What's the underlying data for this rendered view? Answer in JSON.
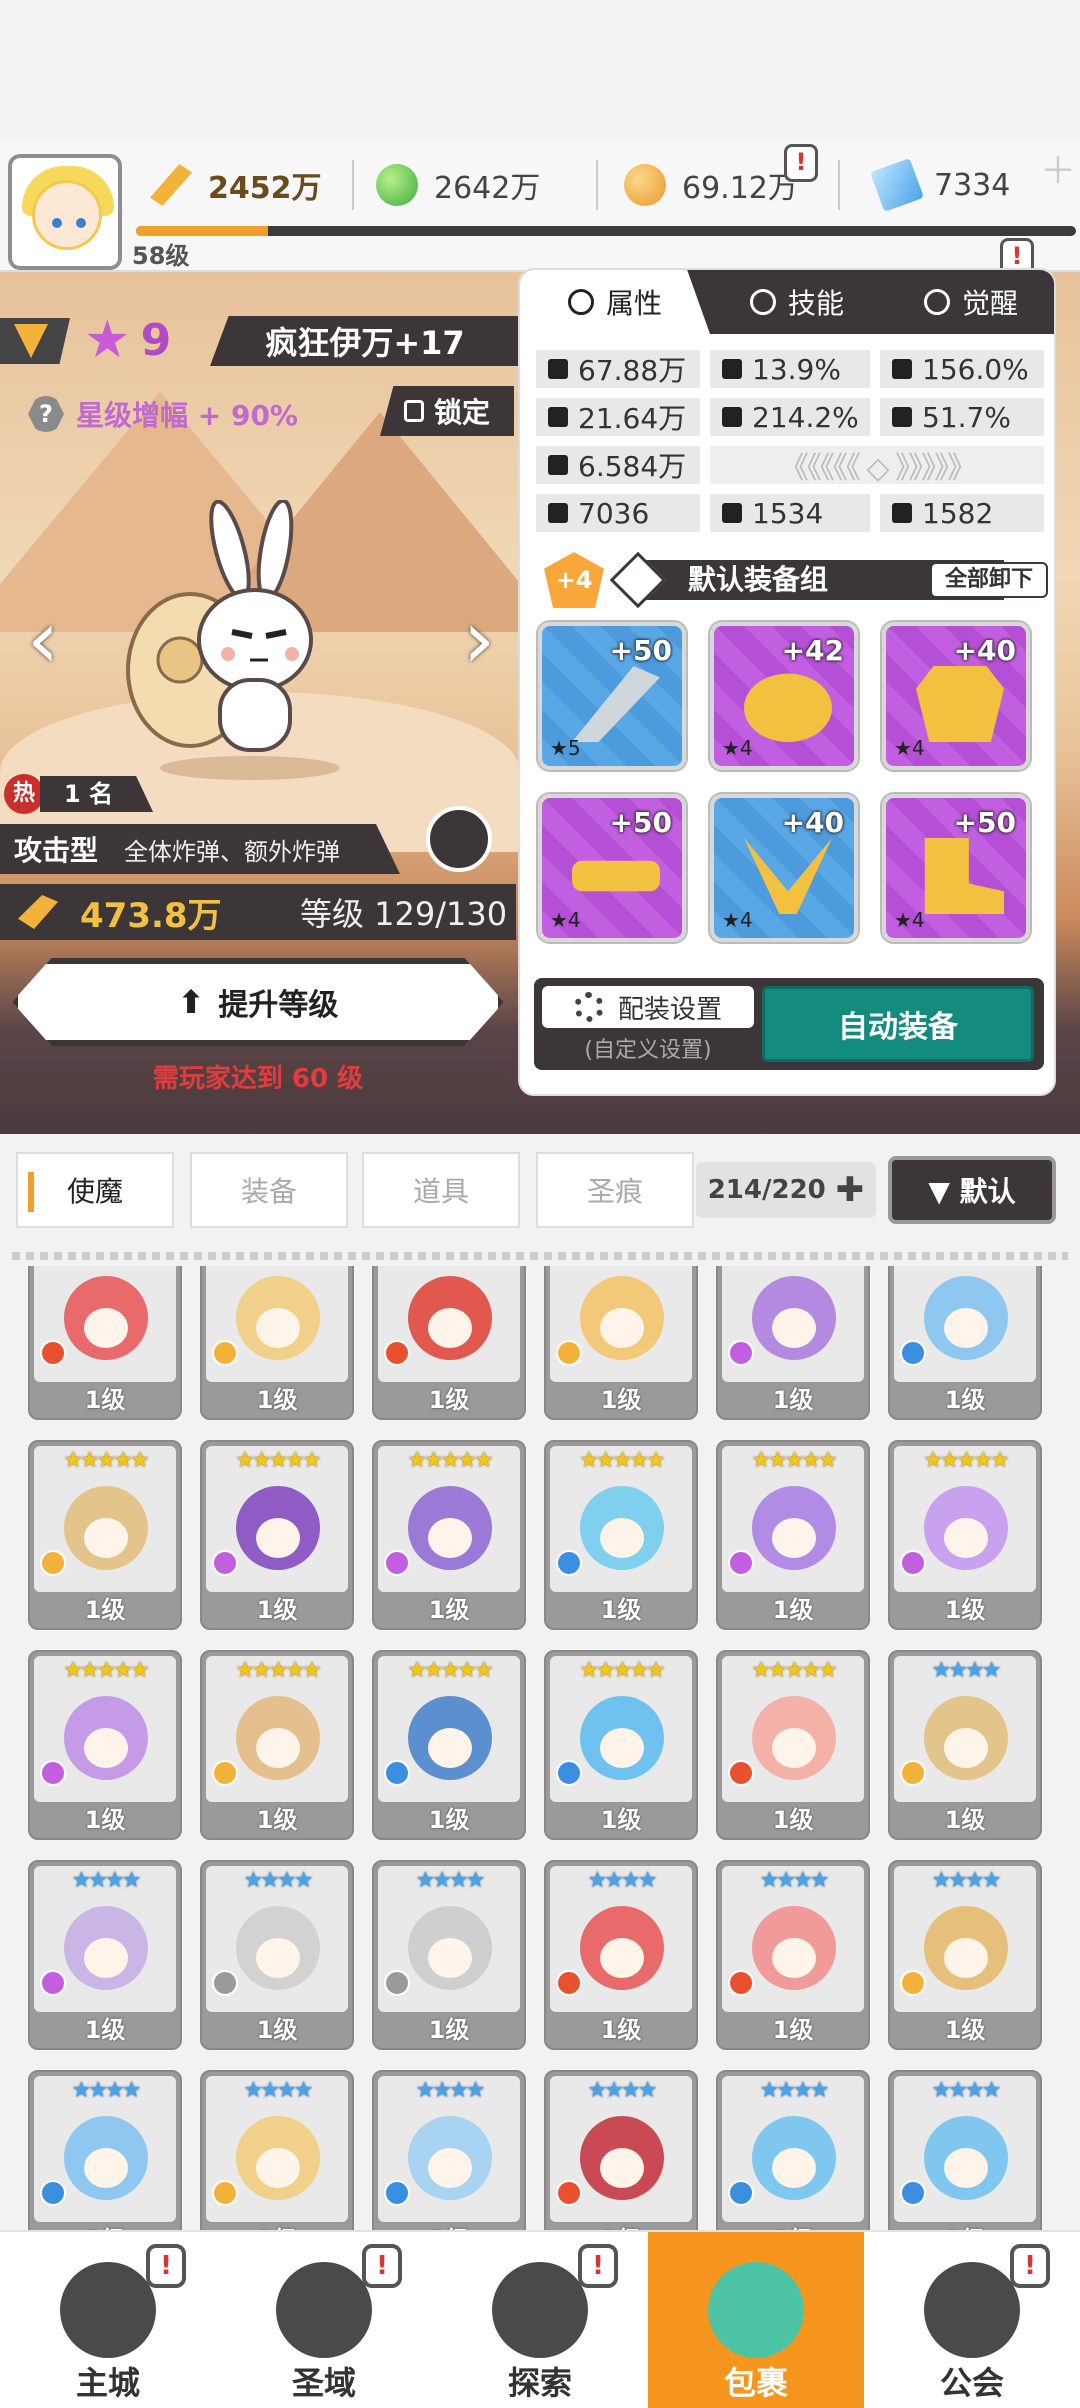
{
  "topbar": {
    "player_level": "58级",
    "power": "2452万",
    "gems": "2642万",
    "gold": "69.12万",
    "crystal": "7334",
    "xp_progress": 0.14
  },
  "hero": {
    "stars": "9",
    "name": "疯狂伊万+17",
    "star_bonus": "星级增幅 + 90%",
    "lock_label": "锁定",
    "hot_rank": "1 名",
    "hot_icon": "热",
    "attack_type": "攻击型",
    "skill_desc": "全体炸弹、额外炸弹",
    "power": "473.8万",
    "level_text": "等级 129/130",
    "upgrade_label": "提升等级",
    "requirement": "需玩家达到 60 级"
  },
  "panel": {
    "tabs": [
      {
        "label": "属性",
        "icon": "attribute-icon"
      },
      {
        "label": "技能",
        "icon": "skill-icon"
      },
      {
        "label": "觉醒",
        "icon": "awaken-icon"
      }
    ],
    "stats": {
      "hp": "67.88万",
      "crit": "13.9%",
      "crit_dmg": "156.0%",
      "atk": "21.64万",
      "accuracy": "214.2%",
      "speed": "51.7%",
      "def": "6.584万",
      "s1": "7036",
      "s2": "1534",
      "s3": "1582"
    },
    "enhance_badge": "+4",
    "equip_set_name": "默认装备组",
    "unload_all": "全部卸下",
    "equipment": [
      {
        "plus": "+50",
        "stars": "★5",
        "kind": "sword",
        "color": "blue"
      },
      {
        "plus": "+42",
        "stars": "★4",
        "kind": "helmet",
        "color": "purple"
      },
      {
        "plus": "+40",
        "stars": "★4",
        "kind": "armor",
        "color": "purple"
      },
      {
        "plus": "+50",
        "stars": "★4",
        "kind": "belt",
        "color": "purple"
      },
      {
        "plus": "+40",
        "stars": "★4",
        "kind": "necklace",
        "color": "blue"
      },
      {
        "plus": "+50",
        "stars": "★4",
        "kind": "boots",
        "color": "purple"
      }
    ],
    "config_label": "配装设置",
    "config_sub": "(自定义设置)",
    "auto_equip": "自动装备"
  },
  "category_tabs": [
    "使魔",
    "装备",
    "道具",
    "圣痕"
  ],
  "inventory_count": "214/220",
  "sort_label": "▼ 默认",
  "cards": [
    {
      "stars": "★★★★★",
      "tone": "gold",
      "color": "#e86a6a",
      "elem": "#e8502e",
      "level": "1级"
    },
    {
      "stars": "★★★★★",
      "tone": "gold",
      "color": "#f0d08a",
      "elem": "#f3b23a",
      "level": "1级"
    },
    {
      "stars": "★★★★★",
      "tone": "gold",
      "color": "#e0584e",
      "elem": "#e8502e",
      "level": "1级"
    },
    {
      "stars": "★★★★★",
      "tone": "gold",
      "color": "#f2c879",
      "elem": "#f3b23a",
      "level": "1级"
    },
    {
      "stars": "★★★★★",
      "tone": "gold",
      "color": "#b48ae0",
      "elem": "#c25fe0",
      "level": "1级"
    },
    {
      "stars": "★★★★★",
      "tone": "gold",
      "color": "#8ec7ef",
      "elem": "#3b8fe0",
      "level": "1级"
    },
    {
      "stars": "★★★★★",
      "tone": "gold",
      "color": "#e3c48a",
      "elem": "#f3b23a",
      "level": "1级"
    },
    {
      "stars": "★★★★★",
      "tone": "gold",
      "color": "#8e5cc4",
      "elem": "#c25fe0",
      "level": "1级"
    },
    {
      "stars": "★★★★★",
      "tone": "gold",
      "color": "#9a7ad6",
      "elem": "#c25fe0",
      "level": "1级"
    },
    {
      "stars": "★★★★★",
      "tone": "gold",
      "color": "#7fd0ef",
      "elem": "#3b8fe0",
      "level": "1级"
    },
    {
      "stars": "★★★★★",
      "tone": "gold",
      "color": "#b28be6",
      "elem": "#c25fe0",
      "level": "1级"
    },
    {
      "stars": "★★★★★",
      "tone": "gold",
      "color": "#c9a2ef",
      "elem": "#c25fe0",
      "level": "1级"
    },
    {
      "stars": "★★★★★",
      "tone": "gold",
      "color": "#c59be8",
      "elem": "#c25fe0",
      "level": "1级"
    },
    {
      "stars": "★★★★★",
      "tone": "gold",
      "color": "#e5c08e",
      "elem": "#f3b23a",
      "level": "1级"
    },
    {
      "stars": "★★★★★",
      "tone": "gold",
      "color": "#5c8fd0",
      "elem": "#3b8fe0",
      "level": "1级"
    },
    {
      "stars": "★★★★★",
      "tone": "gold",
      "color": "#6fc2ef",
      "elem": "#3b8fe0",
      "level": "1级"
    },
    {
      "stars": "★★★★★",
      "tone": "gold",
      "color": "#f4b1a8",
      "elem": "#e8502e",
      "level": "1级"
    },
    {
      "stars": "★★★★",
      "tone": "blue",
      "color": "#e3c48a",
      "elem": "#f3b23a",
      "level": "1级"
    },
    {
      "stars": "★★★★",
      "tone": "blue",
      "color": "#c9b6e6",
      "elem": "#c25fe0",
      "level": "1级"
    },
    {
      "stars": "★★★★",
      "tone": "blue",
      "color": "#d2d2d2",
      "elem": "#9a9a9a",
      "level": "1级"
    },
    {
      "stars": "★★★★",
      "tone": "blue",
      "color": "#cfcfcf",
      "elem": "#9a9a9a",
      "level": "1级"
    },
    {
      "stars": "★★★★",
      "tone": "blue",
      "color": "#e86a6a",
      "elem": "#e8502e",
      "level": "1级"
    },
    {
      "stars": "★★★★",
      "tone": "blue",
      "color": "#f19a9a",
      "elem": "#e8502e",
      "level": "1级"
    },
    {
      "stars": "★★★★",
      "tone": "blue",
      "color": "#e6c07a",
      "elem": "#f3b23a",
      "level": "1级"
    },
    {
      "stars": "★★★★",
      "tone": "blue",
      "color": "#8ec7ef",
      "elem": "#3b8fe0",
      "level": "1级"
    },
    {
      "stars": "★★★★",
      "tone": "blue",
      "color": "#f0d08a",
      "elem": "#f3b23a",
      "level": "1级"
    },
    {
      "stars": "★★★★",
      "tone": "blue",
      "color": "#a8d4f2",
      "elem": "#3b8fe0",
      "level": "1级"
    },
    {
      "stars": "★★★★",
      "tone": "blue",
      "color": "#c94a55",
      "elem": "#e8502e",
      "level": "1级"
    },
    {
      "stars": "★★★★",
      "tone": "blue",
      "color": "#7fc7ef",
      "elem": "#3b8fe0",
      "level": "1级"
    },
    {
      "stars": "★★★★",
      "tone": "blue",
      "color": "#7fc7ef",
      "elem": "#3b8fe0",
      "level": "1级"
    }
  ],
  "nav": [
    {
      "label": "主城",
      "icon": "castle-icon",
      "badge": "!"
    },
    {
      "label": "圣域",
      "icon": "portal-icon",
      "badge": "!"
    },
    {
      "label": "探索",
      "icon": "sword-stone-icon",
      "badge": "!"
    },
    {
      "label": "包裹",
      "icon": "bag-icon",
      "badge": ""
    },
    {
      "label": "公会",
      "icon": "guild-icon",
      "badge": "!"
    }
  ],
  "alert_mark": "!",
  "stat_chevrons": "《《《《《 ◇ 》》》》》"
}
